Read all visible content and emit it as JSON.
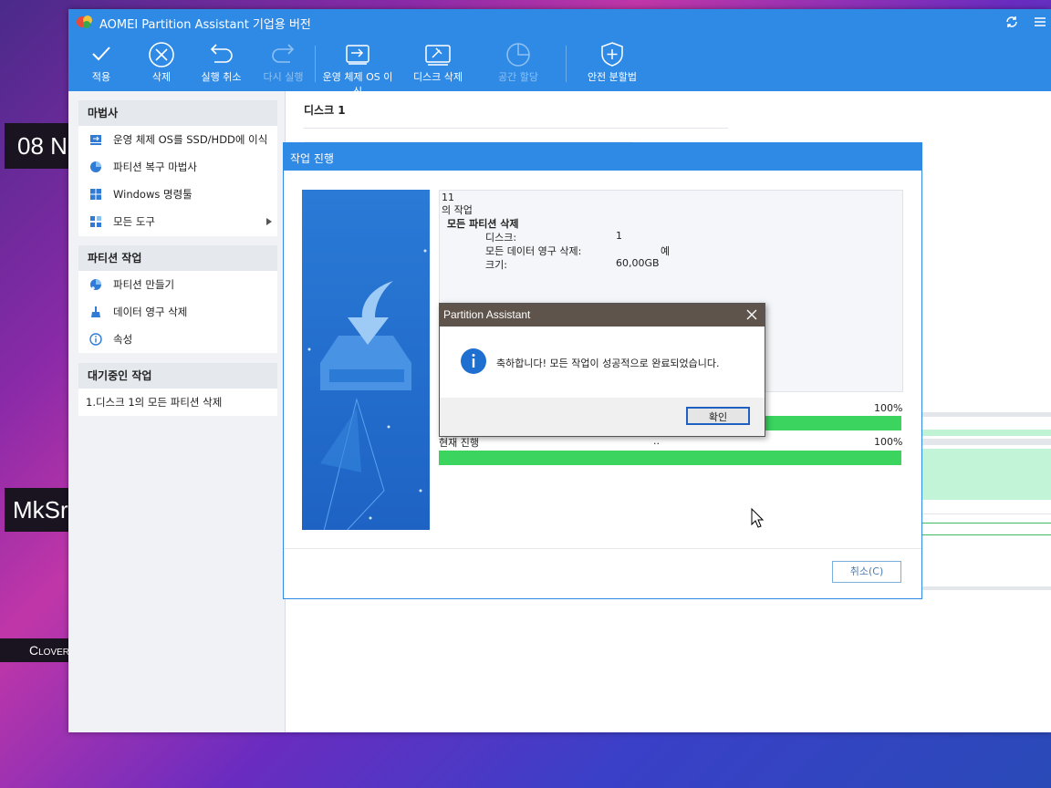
{
  "desktop": {
    "labels": [
      "08 N",
      "MkSr",
      "Clover"
    ]
  },
  "window": {
    "title": "AOMEI Partition Assistant 기업용 버전"
  },
  "toolbar": {
    "apply": "적용",
    "delete": "삭제",
    "undo": "실행 취소",
    "redo": "다시 실행",
    "migrate_os": "운영 체제 OS 이식",
    "wipe_disk": "디스크 삭제",
    "allocate_space": "공간 할당",
    "safe_partition": "안전 분할법"
  },
  "sidebar": {
    "wizard": {
      "header": "마법사",
      "items": [
        "운영 체제 OS를 SSD/HDD에 이식",
        "파티션 복구 마법사",
        "Windows 명령툴",
        "모든 도구"
      ]
    },
    "partition_ops": {
      "header": "파티션 작업",
      "items": [
        "파티션 만들기",
        "데이터 영구 삭제",
        "속성"
      ]
    },
    "pending": {
      "header": "대기중인 작업",
      "items": [
        "1.디스크 1의 모든 파티션 삭제"
      ]
    }
  },
  "main": {
    "disk_label": "디스크 1"
  },
  "progress_dialog": {
    "title": "작업 진행",
    "log": {
      "line1": "11",
      "line2": "의 작업",
      "op_title": "모든 파티션 삭제",
      "disk_label": "디스크:",
      "disk_value": "1",
      "wipe_label": "모든 데이터 영구 삭제:",
      "wipe_value": "예",
      "size_label": "크기:",
      "size_value": "60,00GB"
    },
    "overall_percent_text": "100%",
    "current_label": "현재 진행",
    "current_dots": "..",
    "current_percent_text": "100%",
    "overall_progress": 1.0,
    "current_progress": 1.0,
    "cancel": "취소(C)"
  },
  "message_box": {
    "title": "Partition Assistant",
    "message": "축하합니다! 모든 작업이 성공적으로 완료되었습니다.",
    "ok": "확인"
  },
  "colors": {
    "accent": "#2f8ae6",
    "progress": "#3ad45f"
  }
}
